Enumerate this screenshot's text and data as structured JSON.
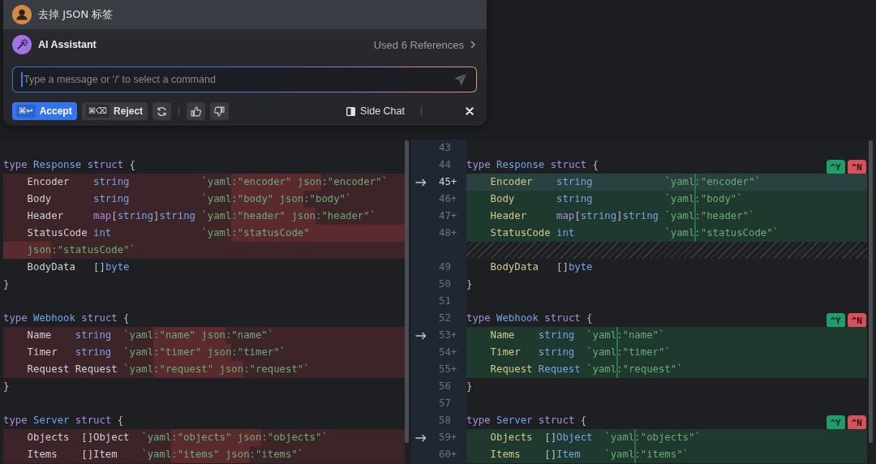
{
  "popup": {
    "prompt": "去掉 JSON 标签",
    "assistant": {
      "name": "AI Assistant",
      "references": "Used 6 References"
    },
    "input": {
      "placeholder": "Type a message or '/' to select a command"
    },
    "buttons": [
      {
        "kind": "accept",
        "shortcut": "⌘↩",
        "label": "Accept"
      },
      {
        "kind": "reject",
        "shortcut": "⌘⌫",
        "label": "Reject"
      }
    ],
    "side_chat": {
      "label": "Side Chat"
    }
  },
  "diff": {
    "left": {
      "lines": [
        {
          "kind": "context"
        },
        {
          "kind": "context",
          "tokens": [
            {
              "text": "type ",
              "kind": "keyword"
            },
            {
              "text": "Response ",
              "kind": "type"
            },
            {
              "text": "struct ",
              "kind": "keyword"
            },
            {
              "text": "{",
              "kind": "punct"
            }
          ]
        },
        {
          "kind": "removed",
          "tokens": [
            {
              "text": "    Encoder    ",
              "kind": "plain"
            },
            {
              "text": "string            ",
              "kind": "type"
            },
            {
              "text": "`yaml",
              "kind": "tag"
            },
            {
              "text": ":\"encoder\" json",
              "kind": "deleted"
            },
            {
              "text": ":\"encoder\"`",
              "kind": "tag"
            }
          ]
        },
        {
          "kind": "removed",
          "tokens": [
            {
              "text": "    Body       ",
              "kind": "plain"
            },
            {
              "text": "string            ",
              "kind": "type"
            },
            {
              "text": "`yaml",
              "kind": "tag"
            },
            {
              "text": ":\"body\" json",
              "kind": "deleted"
            },
            {
              "text": ":\"body\"`",
              "kind": "tag"
            }
          ]
        },
        {
          "kind": "removed",
          "tokens": [
            {
              "text": "    Header     ",
              "kind": "plain"
            },
            {
              "text": "map",
              "kind": "keyword"
            },
            {
              "text": "[",
              "kind": "punct"
            },
            {
              "text": "string",
              "kind": "type"
            },
            {
              "text": "]",
              "kind": "punct"
            },
            {
              "text": "string ",
              "kind": "type"
            },
            {
              "text": "`yaml",
              "kind": "tag"
            },
            {
              "text": ":\"header\" json",
              "kind": "deleted"
            },
            {
              "text": ":\"header\"`",
              "kind": "tag"
            }
          ]
        },
        {
          "kind": "removed",
          "tokens": [
            {
              "text": "    StatusCode ",
              "kind": "plain"
            },
            {
              "text": "int               ",
              "kind": "type"
            },
            {
              "text": "`yaml",
              "kind": "tag"
            },
            {
              "text": ":\"statusCode\" ",
              "kind": "deleted"
            }
          ],
          "continuation": [
            {
              "text": "    json",
              "kind": "deleted"
            },
            {
              "text": ":\"statusCode\"`",
              "kind": "tag"
            }
          ]
        },
        {
          "kind": "context",
          "tokens": [
            {
              "text": "    BodyData   ",
              "kind": "plain"
            },
            {
              "text": "[]",
              "kind": "punct"
            },
            {
              "text": "byte",
              "kind": "type"
            }
          ]
        },
        {
          "kind": "context",
          "tokens": [
            {
              "text": "}",
              "kind": "punct"
            }
          ]
        },
        {
          "kind": "context"
        },
        {
          "kind": "context",
          "tokens": [
            {
              "text": "type ",
              "kind": "keyword"
            },
            {
              "text": "Webhook ",
              "kind": "type"
            },
            {
              "text": "struct ",
              "kind": "keyword"
            },
            {
              "text": "{",
              "kind": "punct"
            }
          ]
        },
        {
          "kind": "removed",
          "tokens": [
            {
              "text": "    Name    ",
              "kind": "plain"
            },
            {
              "text": "string  ",
              "kind": "type"
            },
            {
              "text": "`yaml",
              "kind": "tag"
            },
            {
              "text": ":\"name\" json",
              "kind": "deleted"
            },
            {
              "text": ":\"name\"`",
              "kind": "tag"
            }
          ]
        },
        {
          "kind": "removed",
          "tokens": [
            {
              "text": "    Timer   ",
              "kind": "plain"
            },
            {
              "text": "string  ",
              "kind": "type"
            },
            {
              "text": "`yaml",
              "kind": "tag"
            },
            {
              "text": ":\"timer\" json",
              "kind": "deleted"
            },
            {
              "text": ":\"timer\"`",
              "kind": "tag"
            }
          ]
        },
        {
          "kind": "removed",
          "tokens": [
            {
              "text": "    Request Request ",
              "kind": "plain"
            },
            {
              "text": "`yaml",
              "kind": "tag"
            },
            {
              "text": ":\"request\" json",
              "kind": "deleted"
            },
            {
              "text": ":\"request\"`",
              "kind": "tag"
            }
          ]
        },
        {
          "kind": "context",
          "tokens": [
            {
              "text": "}",
              "kind": "punct"
            }
          ]
        },
        {
          "kind": "context"
        },
        {
          "kind": "context",
          "tokens": [
            {
              "text": "type ",
              "kind": "keyword"
            },
            {
              "text": "Server ",
              "kind": "type"
            },
            {
              "text": "struct ",
              "kind": "keyword"
            },
            {
              "text": "{",
              "kind": "punct"
            }
          ]
        },
        {
          "kind": "removed",
          "tokens": [
            {
              "text": "    Objects  []Object  ",
              "kind": "plain"
            },
            {
              "text": "`yaml",
              "kind": "tag"
            },
            {
              "text": ":\"objects\" json",
              "kind": "deleted"
            },
            {
              "text": ":\"objects\"`",
              "kind": "tag"
            }
          ]
        },
        {
          "kind": "removed",
          "tokens": [
            {
              "text": "    Items    []Item    ",
              "kind": "plain"
            },
            {
              "text": "`yaml",
              "kind": "tag"
            },
            {
              "text": ":\"items\" json",
              "kind": "deleted"
            },
            {
              "text": ":\"items\"`",
              "kind": "tag"
            }
          ]
        }
      ]
    },
    "right": {
      "lines": [
        {
          "number": "43",
          "kind": "context",
          "current": false,
          "apply_arrow": false
        },
        {
          "number": "44",
          "kind": "context",
          "current": false,
          "apply_arrow": false,
          "tokens": [
            {
              "text": "type ",
              "kind": "keyword"
            },
            {
              "text": "Response ",
              "kind": "type"
            },
            {
              "text": "struct ",
              "kind": "keyword"
            },
            {
              "text": "{",
              "kind": "punct"
            }
          ],
          "badges": [
            {
              "label": "^Y",
              "kind": "accept"
            },
            {
              "label": "^N",
              "kind": "reject"
            }
          ]
        },
        {
          "number": "45+",
          "kind": "added",
          "current": true,
          "apply_arrow": true,
          "tokens": [
            {
              "text": "    Encoder    ",
              "kind": "field"
            },
            {
              "text": "string            ",
              "kind": "type"
            },
            {
              "text": "`yaml",
              "kind": "tag"
            },
            {
              "kind": "marker"
            },
            {
              "text": ":\"encoder\"`",
              "kind": "tag"
            }
          ]
        },
        {
          "number": "46+",
          "kind": "added",
          "current": false,
          "apply_arrow": false,
          "tokens": [
            {
              "text": "    Body       ",
              "kind": "field"
            },
            {
              "text": "string            ",
              "kind": "type"
            },
            {
              "text": "`yaml",
              "kind": "tag"
            },
            {
              "kind": "marker"
            },
            {
              "text": ":\"body\"`",
              "kind": "tag"
            }
          ]
        },
        {
          "number": "47+",
          "kind": "added",
          "current": false,
          "apply_arrow": false,
          "tokens": [
            {
              "text": "    Header     ",
              "kind": "field"
            },
            {
              "text": "map",
              "kind": "keyword"
            },
            {
              "text": "[",
              "kind": "punct"
            },
            {
              "text": "string",
              "kind": "type"
            },
            {
              "text": "]",
              "kind": "punct"
            },
            {
              "text": "string ",
              "kind": "type"
            },
            {
              "text": "`yaml",
              "kind": "tag"
            },
            {
              "kind": "marker"
            },
            {
              "text": ":\"header\"`",
              "kind": "tag"
            }
          ]
        },
        {
          "number": "48+",
          "kind": "added",
          "current": false,
          "apply_arrow": false,
          "tokens": [
            {
              "text": "    StatusCode ",
              "kind": "field"
            },
            {
              "text": "int               ",
              "kind": "type"
            },
            {
              "text": "`yaml",
              "kind": "tag"
            },
            {
              "kind": "marker"
            },
            {
              "text": ":\"statusCode\"`",
              "kind": "tag"
            }
          ]
        },
        {
          "kind": "gap",
          "current": false,
          "apply_arrow": false
        },
        {
          "number": "49",
          "kind": "context",
          "current": false,
          "apply_arrow": false,
          "tokens": [
            {
              "text": "    BodyData   ",
              "kind": "field"
            },
            {
              "text": "[]",
              "kind": "punct"
            },
            {
              "text": "byte",
              "kind": "type"
            }
          ]
        },
        {
          "number": "50",
          "kind": "context",
          "current": false,
          "apply_arrow": false,
          "tokens": [
            {
              "text": "}",
              "kind": "punct"
            }
          ]
        },
        {
          "number": "51",
          "kind": "context",
          "current": false,
          "apply_arrow": false
        },
        {
          "number": "52",
          "kind": "context",
          "current": false,
          "apply_arrow": false,
          "tokens": [
            {
              "text": "type ",
              "kind": "keyword"
            },
            {
              "text": "Webhook ",
              "kind": "type"
            },
            {
              "text": "struct ",
              "kind": "keyword"
            },
            {
              "text": "{",
              "kind": "punct"
            }
          ],
          "badges": [
            {
              "label": "^Y",
              "kind": "accept"
            },
            {
              "label": "^N",
              "kind": "reject"
            }
          ]
        },
        {
          "number": "53+",
          "kind": "added",
          "current": false,
          "apply_arrow": true,
          "tokens": [
            {
              "text": "    Name    ",
              "kind": "field"
            },
            {
              "text": "string  ",
              "kind": "type"
            },
            {
              "text": "`yaml",
              "kind": "tag"
            },
            {
              "kind": "marker"
            },
            {
              "text": ":\"name\"`",
              "kind": "tag"
            }
          ]
        },
        {
          "number": "54+",
          "kind": "added",
          "current": false,
          "apply_arrow": false,
          "tokens": [
            {
              "text": "    Timer   ",
              "kind": "field"
            },
            {
              "text": "string  ",
              "kind": "type"
            },
            {
              "text": "`yaml",
              "kind": "tag"
            },
            {
              "kind": "marker"
            },
            {
              "text": ":\"timer\"`",
              "kind": "tag"
            }
          ]
        },
        {
          "number": "55+",
          "kind": "added",
          "current": false,
          "apply_arrow": false,
          "tokens": [
            {
              "text": "    Request ",
              "kind": "field"
            },
            {
              "text": "Request ",
              "kind": "type"
            },
            {
              "text": "`yaml",
              "kind": "tag"
            },
            {
              "kind": "marker"
            },
            {
              "text": ":\"request\"`",
              "kind": "tag"
            }
          ]
        },
        {
          "number": "56",
          "kind": "context",
          "current": false,
          "apply_arrow": false,
          "tokens": [
            {
              "text": "}",
              "kind": "punct"
            }
          ]
        },
        {
          "number": "57",
          "kind": "context",
          "current": false,
          "apply_arrow": false
        },
        {
          "number": "58",
          "kind": "context",
          "current": false,
          "apply_arrow": false,
          "tokens": [
            {
              "text": "type ",
              "kind": "keyword"
            },
            {
              "text": "Server ",
              "kind": "type"
            },
            {
              "text": "struct ",
              "kind": "keyword"
            },
            {
              "text": "{",
              "kind": "punct"
            }
          ],
          "badges": [
            {
              "label": "^Y",
              "kind": "accept"
            },
            {
              "label": "^N",
              "kind": "reject"
            }
          ]
        },
        {
          "number": "59+",
          "kind": "added",
          "current": false,
          "apply_arrow": true,
          "tokens": [
            {
              "text": "    Objects  ",
              "kind": "field"
            },
            {
              "text": "[]",
              "kind": "punct"
            },
            {
              "text": "Object  ",
              "kind": "type"
            },
            {
              "text": "`yaml",
              "kind": "tag"
            },
            {
              "kind": "marker"
            },
            {
              "text": ":\"objects\"`",
              "kind": "tag"
            }
          ]
        },
        {
          "number": "60+",
          "kind": "added",
          "current": false,
          "apply_arrow": false,
          "tokens": [
            {
              "text": "    Items    ",
              "kind": "field"
            },
            {
              "text": "[]",
              "kind": "punct"
            },
            {
              "text": "Item    ",
              "kind": "type"
            },
            {
              "text": "`yaml",
              "kind": "tag"
            },
            {
              "kind": "marker"
            },
            {
              "text": ":\"items\"`",
              "kind": "tag"
            }
          ]
        }
      ]
    }
  }
}
